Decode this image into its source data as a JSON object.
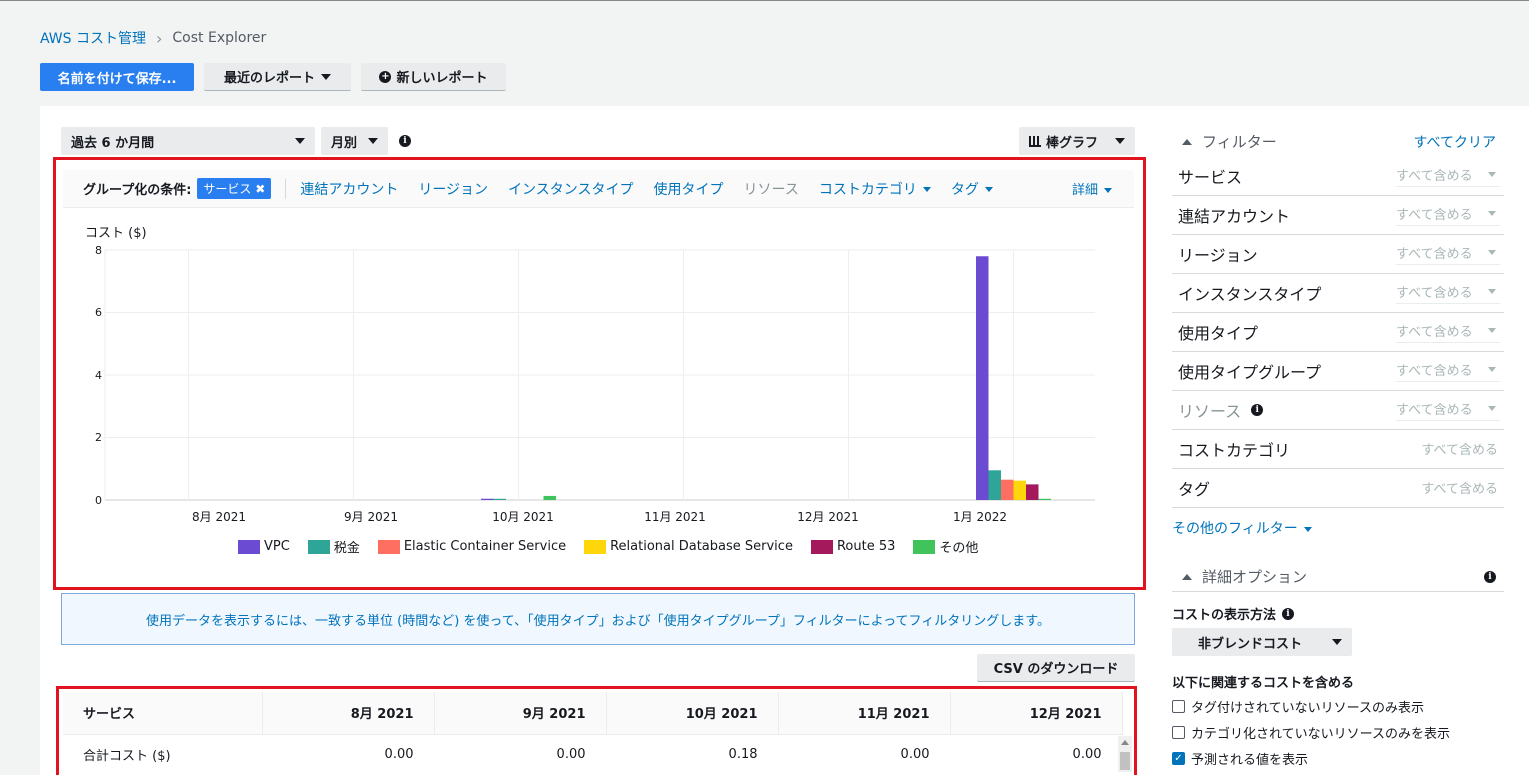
{
  "breadcrumb": {
    "root": "AWS コスト管理",
    "current": "Cost Explorer"
  },
  "toolbar": {
    "save_label": "名前を付けて保存...",
    "recent_label": "最近のレポート",
    "new_label": "新しいレポート"
  },
  "controls": {
    "range": "過去 6 か月間",
    "granularity": "月別",
    "chart_type": "棒グラフ"
  },
  "groupby": {
    "label": "グループ化の条件:",
    "chip": "サービス",
    "options": [
      "連結アカウント",
      "リージョン",
      "インスタンスタイプ",
      "使用タイプ",
      "リソース",
      "コストカテゴリ",
      "タグ"
    ],
    "detail": "詳細"
  },
  "chart_data": {
    "type": "bar",
    "ylabel": "コスト ($)",
    "ylim": [
      0,
      8
    ],
    "yticks": [
      "8",
      "6",
      "4",
      "2",
      "0"
    ],
    "categories": [
      "8月 2021",
      "9月 2021",
      "10月 2021",
      "11月 2021",
      "12月 2021",
      "1月 2022"
    ],
    "series": [
      {
        "name": "VPC",
        "color": "#6b4bd1",
        "values": [
          0,
          0,
          0.04,
          0,
          0,
          7.8
        ]
      },
      {
        "name": "税金",
        "color": "#2ea597",
        "values": [
          0,
          0,
          0.01,
          0,
          0,
          0.95
        ]
      },
      {
        "name": "Elastic Container Service",
        "color": "#ff6f61",
        "values": [
          0,
          0,
          0,
          0,
          0,
          0.65
        ]
      },
      {
        "name": "Relational Database Service",
        "color": "#ffd60a",
        "values": [
          0,
          0,
          0,
          0,
          0,
          0.62
        ]
      },
      {
        "name": "Route 53",
        "color": "#a3195b",
        "values": [
          0,
          0,
          0,
          0,
          0,
          0.5
        ]
      },
      {
        "name": "その他",
        "color": "#3ec45a",
        "values": [
          0,
          0,
          0.13,
          0,
          0,
          0.03
        ]
      }
    ]
  },
  "notice": "使用データを表示するには、一致する単位 (時間など) を使って、「使用タイプ」および「使用タイプグループ」フィルターによってフィルタリングします。",
  "csv_label": "CSV のダウンロード",
  "table": {
    "headers": [
      "サービス",
      "8月 2021",
      "9月 2021",
      "10月 2021",
      "11月 2021",
      "12月 2021"
    ],
    "row_label": "合計コスト ($)",
    "row_values": [
      "0.00",
      "0.00",
      "0.18",
      "0.00",
      "0.00"
    ]
  },
  "filters": {
    "title": "フィルター",
    "clear": "すべてクリア",
    "items": [
      {
        "name": "サービス",
        "value": "すべて含める"
      },
      {
        "name": "連結アカウント",
        "value": "すべて含める"
      },
      {
        "name": "リージョン",
        "value": "すべて含める"
      },
      {
        "name": "インスタンスタイプ",
        "value": "すべて含める"
      },
      {
        "name": "使用タイプ",
        "value": "すべて含める"
      },
      {
        "name": "使用タイプグループ",
        "value": "すべて含める"
      },
      {
        "name": "リソース",
        "value": "すべて含める"
      },
      {
        "name": "コストカテゴリ",
        "value": "すべて含める"
      },
      {
        "name": "タグ",
        "value": "すべて含める"
      }
    ],
    "more": "その他のフィルター"
  },
  "advanced": {
    "title": "詳細オプション",
    "display_label": "コストの表示方法",
    "display_value": "非ブレンドコスト",
    "include_label": "以下に関連するコストを含める",
    "checks": [
      {
        "label": "タグ付けされていないリソースのみ表示",
        "checked": false
      },
      {
        "label": "カテゴリ化されていないリソースのみを表示",
        "checked": false
      },
      {
        "label": "予測される値を表示",
        "checked": true
      }
    ]
  }
}
